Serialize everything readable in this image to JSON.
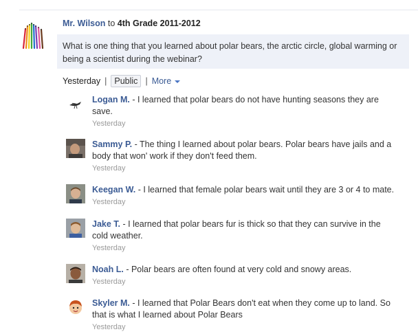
{
  "post": {
    "author": "Mr. Wilson",
    "to_word": "to",
    "group": "4th Grade 2011-2012",
    "question": "What is one thing that you learned about polar bears, the arctic circle, global warming or being a scientist during the webinar?",
    "meta": {
      "time": "Yesterday",
      "separator": "|",
      "visibility": "Public",
      "more": "More"
    }
  },
  "comments": [
    {
      "name": "Logan M.",
      "text": " - I learned that polar bears do not have hunting seasons they are save.",
      "time": "Yesterday",
      "avatar": "bird-icon"
    },
    {
      "name": "Sammy P.",
      "text": " - The thing I learned about polar bears. Polar bears have jails and a body that won' work if they don't feed them.",
      "time": "Yesterday",
      "avatar": "photo-avatar"
    },
    {
      "name": "Keegan W.",
      "text": " - I learned that female polar bears wait until they are 3 or 4 to mate.",
      "time": "Yesterday",
      "avatar": "photo-avatar"
    },
    {
      "name": "Jake T.",
      "text": " - I learned that polar bears fur is thick so that they can survive in the cold weather.",
      "time": "Yesterday",
      "avatar": "photo-avatar"
    },
    {
      "name": "Noah L.",
      "text": " - Polar bears are often found at very cold and snowy areas.",
      "time": "Yesterday",
      "avatar": "photo-avatar"
    },
    {
      "name": "Skyler M.",
      "text": " - I learned that Polar Bears don't eat when they come up to land. So that is what I learned about Polar Bears",
      "time": "Yesterday",
      "avatar": "cartoon-face-icon"
    }
  ],
  "colors": {
    "link": "#3b5b94",
    "question_bg": "#eef1f8",
    "timestamp": "#9a9a9a"
  }
}
